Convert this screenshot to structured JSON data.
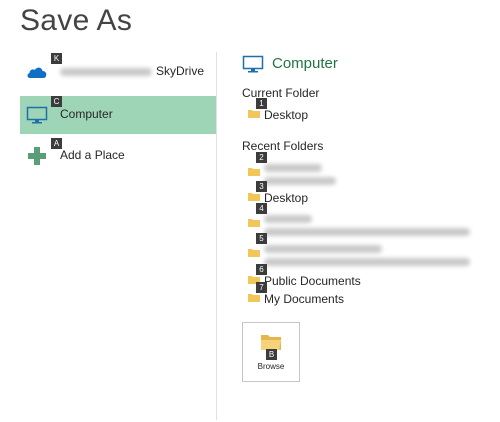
{
  "title": "Save As",
  "places": [
    {
      "label": "SkyDrive",
      "keytip": "K",
      "icon": "skydrive-cloud-icon",
      "selected": false
    },
    {
      "label": "Computer",
      "keytip": "C",
      "icon": "computer-monitor-icon",
      "selected": true
    },
    {
      "label": "Add a Place",
      "keytip": "A",
      "icon": "add-plus-icon",
      "selected": false
    }
  ],
  "right": {
    "heading": "Computer",
    "current_folder_label": "Current Folder",
    "current_folder": {
      "label": "Desktop",
      "keytip": "1"
    },
    "recent_label": "Recent Folders",
    "recent": [
      {
        "keytip": "2",
        "label": null
      },
      {
        "keytip": "3",
        "label": "Desktop"
      },
      {
        "keytip": "4",
        "label": null
      },
      {
        "keytip": "5",
        "label": null
      },
      {
        "keytip": "6",
        "label": "Public Documents"
      },
      {
        "keytip": "7",
        "label": "My Documents"
      }
    ],
    "browse": {
      "label": "Browse",
      "keytip": "B"
    }
  },
  "colors": {
    "accent_green": "#217346",
    "selection_bg": "#9fd5b7",
    "skydrive_blue": "#0f6fc6",
    "folder_yellow": "#f3c65a"
  }
}
